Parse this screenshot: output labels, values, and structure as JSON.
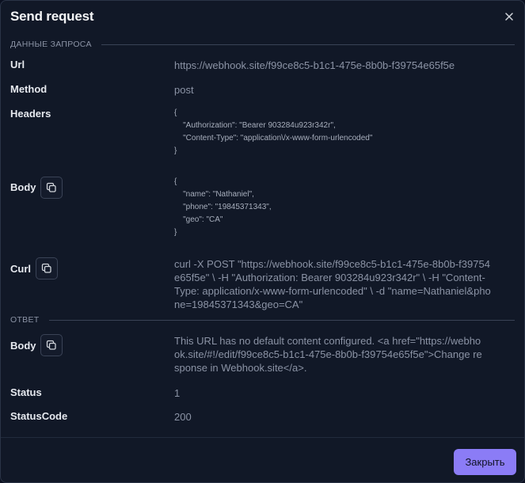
{
  "dialog": {
    "title": "Send request",
    "close_icon": "close-icon"
  },
  "request_section": {
    "heading": "ДАННЫЕ ЗАПРОСА",
    "url_label": "Url",
    "url_value": "https://webhook.site/f99ce8c5-b1c1-475e-8b0b-f39754e65f5e",
    "method_label": "Method",
    "method_value": "post",
    "headers_label": "Headers",
    "headers_value": "{\n    \"Authorization\": \"Bearer 903284u923r342r\",\n    \"Content-Type\": \"application\\/x-www-form-urlencoded\"\n}",
    "body_label": "Body",
    "body_value": "{\n    \"name\": \"Nathaniel\",\n    \"phone\": \"19845371343\",\n    \"geo\": \"CA\"\n}",
    "curl_label": "Curl",
    "curl_value": "curl -X POST \"https://webhook.site/f99ce8c5-b1c1-475e-8b0b-f39754e65f5e\" \\ -H \"Authorization: Bearer 903284u923r342r\" \\ -H \"Content-Type: application/x-www-form-urlencoded\" \\ -d \"name=Nathaniel&phone=19845371343&geo=CA\""
  },
  "response_section": {
    "heading": "ОТВЕТ",
    "body_label": "Body",
    "body_value": "This URL has no default content configured. <a href=\"https://webhook.site/#!/edit/f99ce8c5-b1c1-475e-8b0b-f39754e65f5e\">Change response in Webhook.site</a>.",
    "status_label": "Status",
    "status_value": "1",
    "status_code_label": "StatusCode",
    "status_code_value": "200"
  },
  "footer": {
    "close_label": "Закрыть"
  },
  "colors": {
    "accent": "#8b7cf6",
    "background": "#111827",
    "muted_text": "#8b93a5"
  }
}
